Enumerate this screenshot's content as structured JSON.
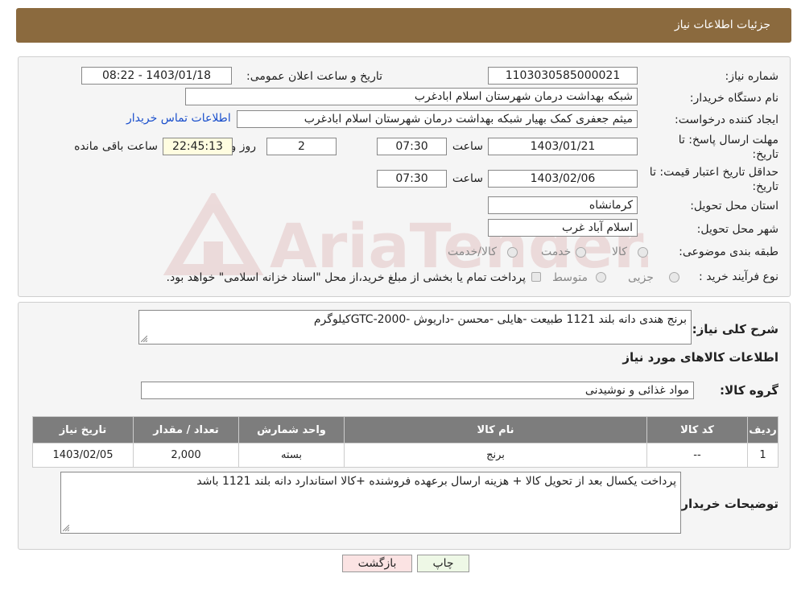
{
  "header": {
    "title": "جزئیات اطلاعات نیاز"
  },
  "form": {
    "need_number_label": "شماره نیاز:",
    "need_number": "1103030585000021",
    "announce_label": "تاریخ و ساعت اعلان عمومی:",
    "announce_value": "1403/01/18 - 08:22",
    "buyer_org_label": "نام دستگاه خریدار:",
    "buyer_org": "شبکه بهداشت درمان شهرستان اسلام ابادغرب",
    "creator_label": "ایجاد کننده درخواست:",
    "creator": "میثم جعفری کمک بهیار شبکه بهداشت درمان شهرستان اسلام ابادغرب",
    "contact_link": "اطلاعات تماس خریدار",
    "deadline_label_1": "مهلت ارسال پاسخ: تا",
    "deadline_label_2": "تاریخ:",
    "deadline_date": "1403/01/21",
    "time_label": "ساعت",
    "deadline_time": "07:30",
    "days_value": "2",
    "days_label": "روز و",
    "remaining_time": "22:45:13",
    "remaining_label": "ساعت باقی مانده",
    "validity_label_1": "حداقل تاریخ اعتبار قیمت: تا",
    "validity_label_2": "تاریخ:",
    "validity_date": "1403/02/06",
    "validity_time": "07:30",
    "province_label": "استان محل تحویل:",
    "province": "کرمانشاه",
    "city_label": "شهر محل تحویل:",
    "city": "اسلام آباد غرب",
    "category_label": "طبقه بندی موضوعی:",
    "category_options": [
      "کالا",
      "خدمت",
      "کالا/خدمت"
    ],
    "process_label": "نوع فرآیند خرید :",
    "process_options": [
      "جزیی",
      "متوسط"
    ],
    "process_note": "پرداخت تمام یا بخشی از مبلغ خرید،از محل \"اسناد خزانه اسلامی\" خواهد بود."
  },
  "details": {
    "summary_label": "شرح کلی نیاز:",
    "summary": "برنج هندی دانه بلند 1121 طبیعت -هایلی -محسن -داریوش -GTC-2000کیلوگرم",
    "goods_info_title": "اطلاعات کالاهای مورد نیاز",
    "goods_group_label": "گروه کالا:",
    "goods_group": "مواد غذائی و نوشیدنی",
    "table": {
      "headers": [
        "ردیف",
        "کد کالا",
        "نام کالا",
        "واحد شمارش",
        "تعداد / مقدار",
        "تاریخ نیاز"
      ],
      "rows": [
        [
          "1",
          "--",
          "برنج",
          "بسته",
          "2,000",
          "1403/02/05"
        ]
      ]
    },
    "buyer_notes_label": "توضیحات خریدار:",
    "buyer_notes": "پرداخت یکسال بعد از تحویل کالا  + هزینه ارسال برعهده فروشنده +کالا استاندارد دانه بلند 1121 باشد"
  },
  "buttons": {
    "print": "چاپ",
    "back": "بازگشت"
  },
  "watermark": {
    "text": "AriaTender.neT"
  },
  "colors": {
    "header_bg": "#8b6a3e",
    "table_header_bg": "#7d7d7d",
    "back_button_bg": "#fbe3e3",
    "print_button_bg": "#eef8e6",
    "link": "#1a4fcc"
  }
}
